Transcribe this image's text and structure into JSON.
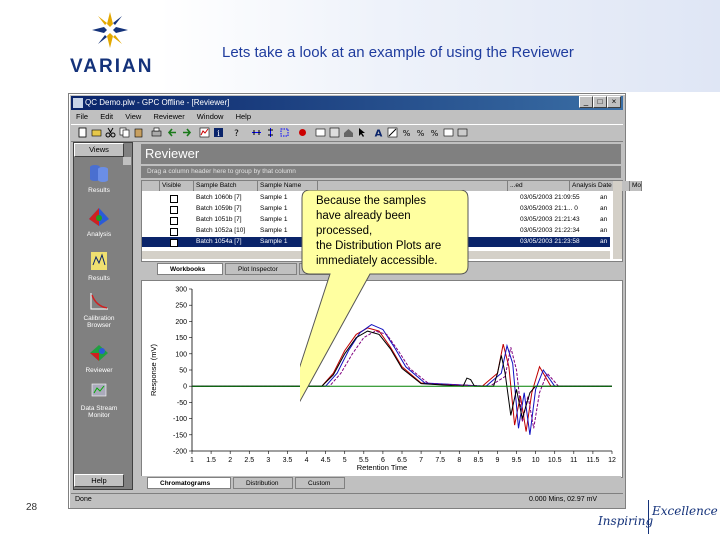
{
  "slide": {
    "brand": "VARIAN",
    "title": "Lets take a look at an example of using the Reviewer",
    "page_number": "28",
    "footer_left": "Inspiring",
    "footer_right": "Excellence"
  },
  "window": {
    "title": "QC Demo.plw - GPC Offline - [Reviewer]",
    "menu": [
      "File",
      "Edit",
      "View",
      "Reviewer",
      "Window",
      "Help"
    ],
    "status_left": "Done",
    "status_right": "0.000 Mins, 02.97 mV"
  },
  "nav": {
    "header": "Views",
    "footer": "Help",
    "items": [
      "Results",
      "Analysis",
      "Results",
      "Calibration Browser",
      "Reviewer",
      "Data Stream Monitor"
    ]
  },
  "reviewer": {
    "heading": "Reviewer",
    "group_hint": "Drag a column header here to group by that column",
    "columns": [
      "Visible",
      "Sample Batch",
      "Sample Name",
      "...ed",
      "Analysis Date",
      "Mo"
    ],
    "rows": [
      {
        "batch": "Batch 1060b [7]",
        "sample": "Sample 1",
        "date": "03/05/2003 21:09:55",
        "mo": "an"
      },
      {
        "batch": "Batch 1059b [7]",
        "sample": "Sample 1",
        "date": "03/05/2003 21:1... 0",
        "mo": "an"
      },
      {
        "batch": "Batch 1051b [7]",
        "sample": "Sample 1",
        "date": "03/05/2003 21:21:43",
        "mo": "an"
      },
      {
        "batch": "Batch 1052a [10]",
        "sample": "Sample 1",
        "date": "03/05/2003 21:22:34",
        "mo": "an"
      },
      {
        "batch": "Batch 1054a [7]",
        "sample": "Sample 1",
        "date": "03/05/2003 21:23:58",
        "mo": "an"
      }
    ],
    "tabs_top": [
      "Workbooks",
      "Plot Inspector",
      "Ra..."
    ],
    "tabs_bottom": [
      "Chromatograms",
      "Distribution",
      "Custom"
    ]
  },
  "callout": {
    "lines": [
      "Because the samples",
      "have already been",
      "processed,",
      "the Distribution Plots are",
      "immediately accessible."
    ]
  },
  "colors": {
    "brand_blue": "#14327a",
    "title_blue": "#1f3c9e",
    "callout_fill": "#ffffa0",
    "selection": "#0a246a"
  },
  "chart_data": {
    "type": "line",
    "title": "",
    "xlabel": "Retention Time",
    "ylabel": "Response (mV)",
    "xlim": [
      1,
      12
    ],
    "ylim": [
      -200,
      300
    ],
    "x_ticks": [
      "1",
      "1.5",
      "2",
      "2.5",
      "3",
      "3.5",
      "4",
      "4.5",
      "5",
      "5.5",
      "6",
      "6.5",
      "7",
      "7.5",
      "8",
      "8.5",
      "9",
      "9.5",
      "10",
      "10.5",
      "11",
      "11.5",
      "12"
    ],
    "y_ticks": [
      "300",
      "250",
      "200",
      "150",
      "100",
      "50",
      "0",
      "-50",
      "-100",
      "-150",
      "-200"
    ],
    "grid": false,
    "series": [
      {
        "color": "#c00000",
        "x": [
          1,
          4.4,
          4.7,
          5.0,
          5.3,
          5.6,
          5.9,
          6.2,
          6.5,
          7.0,
          8.6,
          9.0,
          9.15,
          9.3,
          9.45,
          9.6,
          9.75,
          9.9,
          10.1,
          10.4,
          12
        ],
        "y": [
          0,
          0,
          40,
          110,
          160,
          180,
          170,
          120,
          60,
          10,
          0,
          40,
          130,
          60,
          -120,
          -30,
          -140,
          -20,
          60,
          0,
          0
        ]
      },
      {
        "color": "#1010c0",
        "x": [
          1,
          4.5,
          4.8,
          5.1,
          5.4,
          5.7,
          6.0,
          6.3,
          6.6,
          7.1,
          8.7,
          9.1,
          9.25,
          9.4,
          9.55,
          9.7,
          9.85,
          10.0,
          10.2,
          10.5,
          12
        ],
        "y": [
          0,
          0,
          40,
          110,
          165,
          190,
          175,
          120,
          60,
          10,
          0,
          40,
          125,
          70,
          -130,
          -20,
          -150,
          -10,
          50,
          0,
          0
        ]
      },
      {
        "color": "#800080",
        "x": [
          1,
          4.6,
          4.9,
          5.2,
          5.5,
          5.8,
          6.1,
          6.4,
          6.7,
          7.2,
          8.8,
          9.2,
          9.35,
          9.5,
          9.65,
          9.8,
          9.95,
          10.1,
          10.3,
          10.6,
          12
        ],
        "y": [
          0,
          0,
          40,
          100,
          150,
          170,
          160,
          110,
          55,
          8,
          0,
          30,
          120,
          50,
          -110,
          -30,
          -130,
          -20,
          40,
          0,
          0
        ]
      },
      {
        "color": "#000000",
        "x": [
          1,
          4.4,
          4.7,
          5.0,
          5.3,
          5.6,
          5.9,
          6.2,
          6.5,
          7.0,
          8.1,
          8.2,
          8.3,
          8.4,
          8.9,
          9.0,
          9.1,
          9.2,
          9.35,
          9.5,
          9.65,
          9.85,
          10.0,
          12
        ],
        "y": [
          0,
          0,
          35,
          100,
          150,
          170,
          160,
          115,
          55,
          8,
          0,
          25,
          20,
          0,
          0,
          40,
          95,
          40,
          -90,
          -10,
          -100,
          -20,
          0,
          0
        ]
      },
      {
        "color": "#008000",
        "x": [
          1,
          12
        ],
        "y": [
          0,
          0
        ]
      }
    ]
  }
}
